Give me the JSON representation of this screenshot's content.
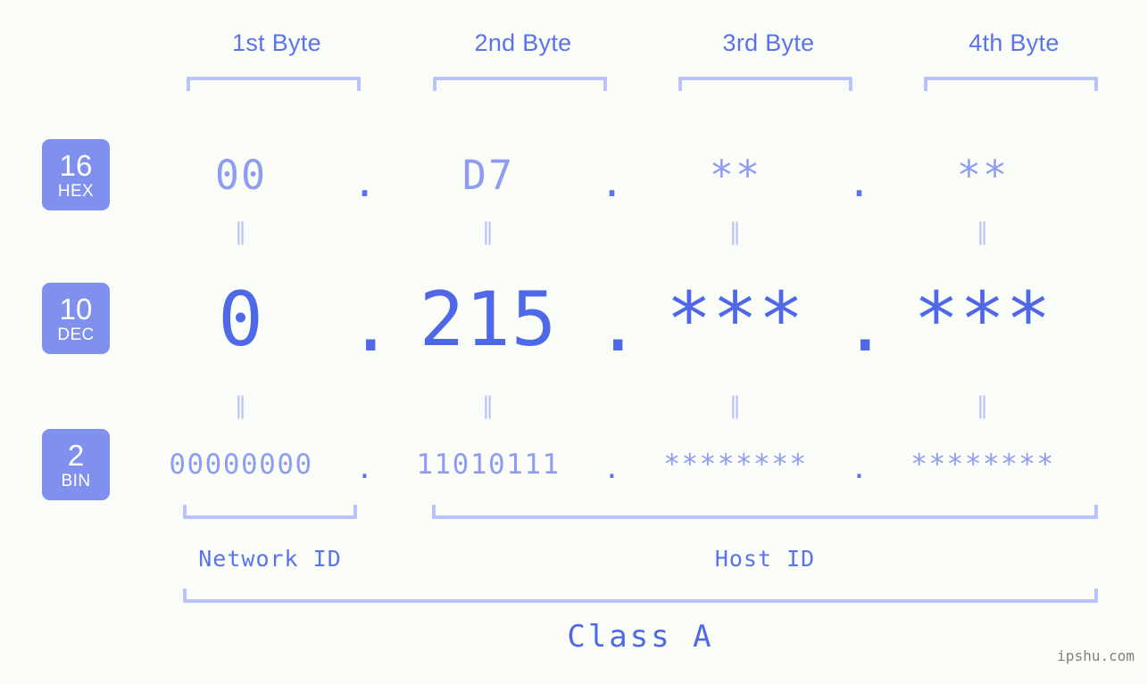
{
  "meta": {
    "background_color": "#fbfdf8",
    "accent_strong": "#4f68e8",
    "accent_mid": "#5b72ee",
    "accent_light": "#8e9cf2",
    "accent_pale": "#b9c2fb",
    "badge_bg": "#8090ee"
  },
  "headers": [
    {
      "label": "1st Byte"
    },
    {
      "label": "2nd Byte"
    },
    {
      "label": "3rd Byte"
    },
    {
      "label": "4th Byte"
    }
  ],
  "bases": [
    {
      "id": "hex",
      "number": "16",
      "name": "HEX"
    },
    {
      "id": "dec",
      "number": "10",
      "name": "DEC"
    },
    {
      "id": "bin",
      "number": "2",
      "name": "BIN"
    }
  ],
  "rows": {
    "hex": {
      "values": [
        "00",
        "D7",
        "**",
        "**"
      ],
      "separators": [
        ".",
        ".",
        "."
      ]
    },
    "dec": {
      "values": [
        "0",
        "215",
        "***",
        "***"
      ],
      "separators": [
        ".",
        ".",
        "."
      ]
    },
    "bin": {
      "values": [
        "00000000",
        "11010111",
        "********",
        "********"
      ],
      "separators": [
        ".",
        ".",
        "."
      ]
    }
  },
  "equality_marks": {
    "symbol": "‖",
    "count": 4
  },
  "segments": [
    {
      "label": "Network ID"
    },
    {
      "label": "Host ID"
    }
  ],
  "class": {
    "label": "Class A"
  },
  "watermark": {
    "text": "ipshu.com"
  }
}
